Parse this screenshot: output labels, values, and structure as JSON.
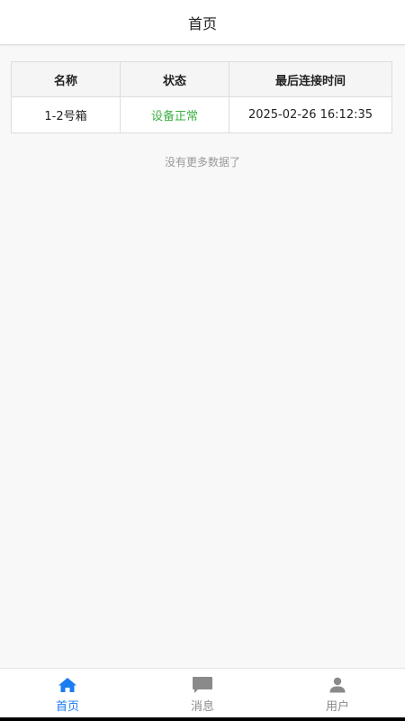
{
  "header": {
    "title": "首页"
  },
  "table": {
    "columns": [
      "名称",
      "状态",
      "最后连接时间"
    ],
    "rows": [
      {
        "name": "1-2号箱",
        "status": "设备正常",
        "last_connect": "2025-02-26 16:12:35"
      }
    ]
  },
  "list_end_text": "没有更多数据了",
  "tabbar": {
    "items": [
      {
        "label": "首页",
        "icon": "home-icon",
        "active": true
      },
      {
        "label": "消息",
        "icon": "message-icon",
        "active": false
      },
      {
        "label": "用户",
        "icon": "user-icon",
        "active": false
      }
    ]
  },
  "colors": {
    "accent": "#1a7cf0",
    "status_ok": "#3cb043",
    "inactive_tab": "#8a8a8a"
  }
}
